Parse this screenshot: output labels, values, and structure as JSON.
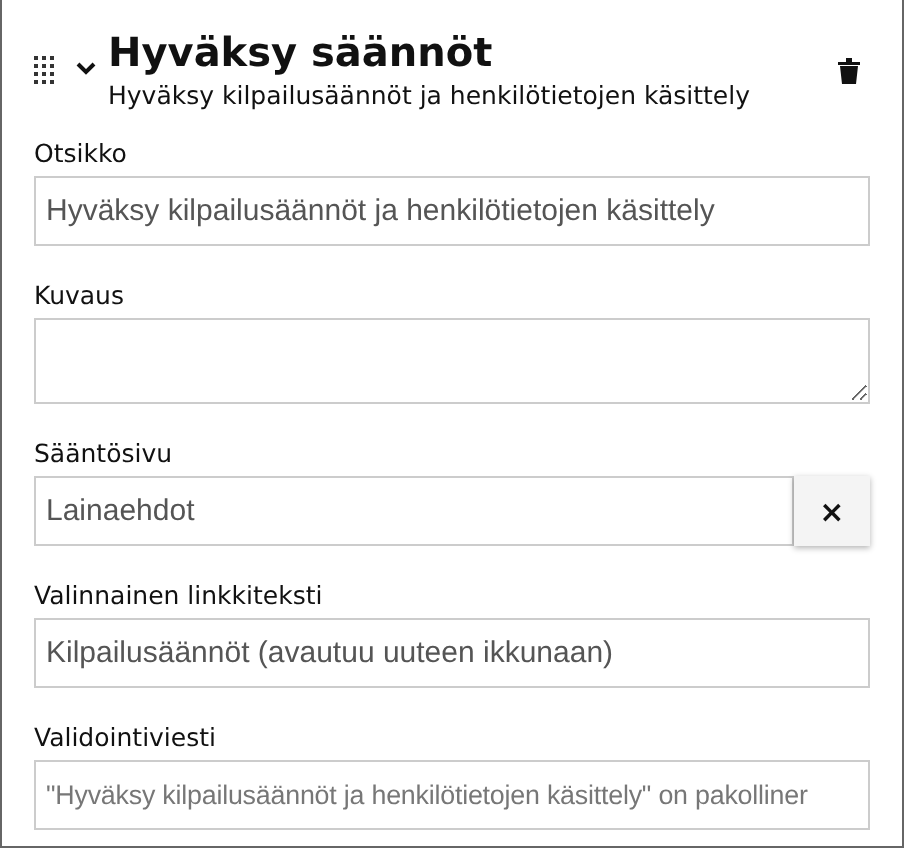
{
  "header": {
    "title": "Hyväksy säännöt",
    "subtitle": "Hyväksy kilpailusäännöt ja henkilötietojen käsittely",
    "expanded": true
  },
  "fields": [
    {
      "kind": "text",
      "label": "Otsikko",
      "value": "Hyväksy kilpailusäännöt ja henkilötietojen käsittely"
    },
    {
      "kind": "textarea",
      "label": "Kuvaus"
    },
    {
      "kind": "picker",
      "label": "Sääntösivu",
      "value": "Lainaehdot",
      "clear": "×"
    },
    {
      "kind": "text",
      "label": "Valinnainen linkkiteksti",
      "value": "Kilpailusäännöt (avautuu uuteen ikkunaan)"
    },
    {
      "kind": "text",
      "label": "Validointiviesti",
      "placeholder": "\"Hyväksy kilpailusäännöt ja henkilötietojen käsittely\" on pakolliner"
    }
  ]
}
